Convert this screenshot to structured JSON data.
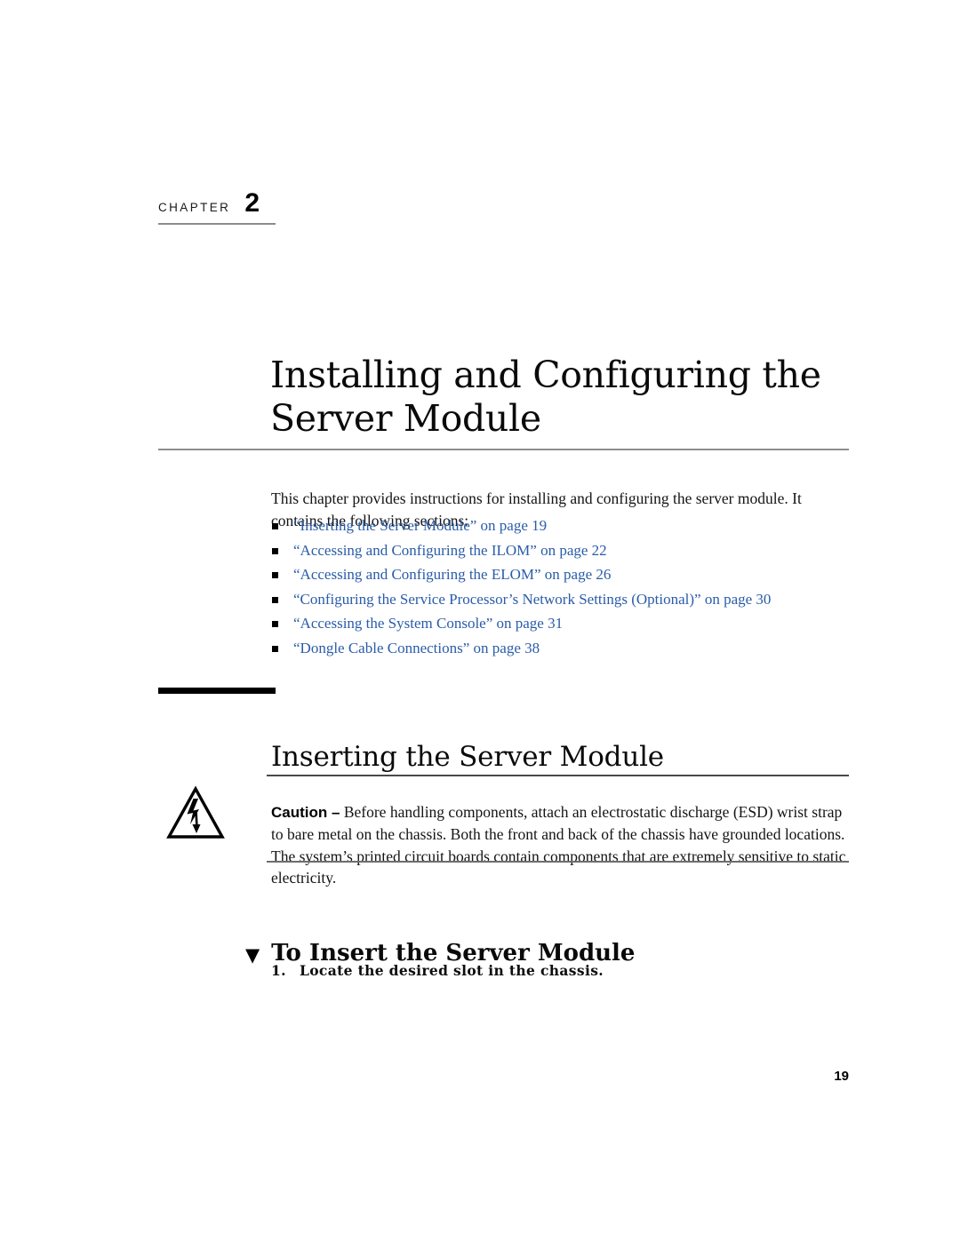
{
  "document": {
    "chapter_label": "CHAPTER",
    "chapter_number": "2",
    "title_line1": "Installing and Configuring the",
    "title_line2": "Server Module",
    "page_number": "19"
  },
  "intro": {
    "text": "This chapter provides instructions for installing and configuring the server module. It contains the following sections:"
  },
  "toc": {
    "items": [
      {
        "label": "“Inserting the Server Module” on page 19"
      },
      {
        "label": "“Accessing and Configuring the ILOM” on page 22"
      },
      {
        "label": "“Accessing and Configuring the ELOM” on page 26"
      },
      {
        "label": "“Configuring the Service Processor’s Network Settings (Optional)” on page 30"
      },
      {
        "label": "“Accessing the System Console” on page 31"
      },
      {
        "label": "“Dongle Cable Connections” on page 38"
      }
    ]
  },
  "section": {
    "heading": "Inserting the Server Module"
  },
  "caution": {
    "label": "Caution –",
    "text": " Before handling components, attach an electrostatic discharge (ESD) wrist strap to bare metal on the chassis. Both the front and back of the chassis have grounded locations. The system’s printed circuit boards contain components that are extremely sensitive to static electricity.",
    "icon": "electrostatic-discharge-warning-icon"
  },
  "procedure": {
    "marker": "▼",
    "heading": "To Insert the Server Module",
    "steps": [
      {
        "number": "1.",
        "text": "Locate the desired slot in the chassis."
      }
    ]
  },
  "colors": {
    "link_blue": "#2a5ca8",
    "rule_gray": "#8e8e8e",
    "rule_black": "#000000"
  }
}
